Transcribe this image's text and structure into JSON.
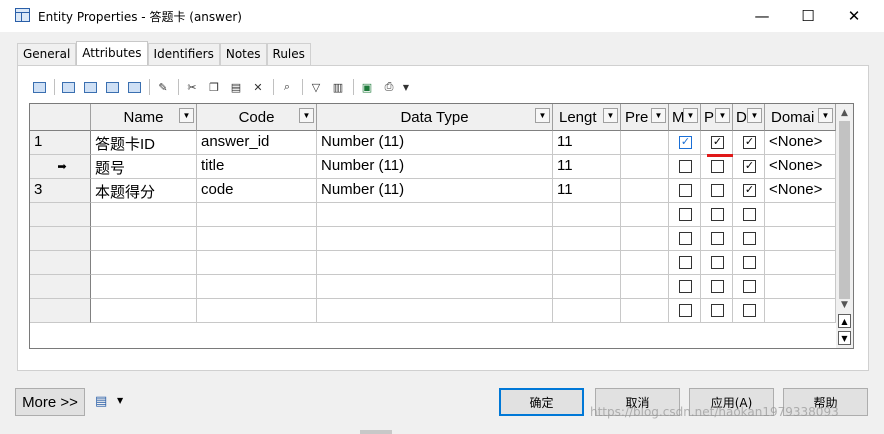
{
  "window": {
    "title": "Entity Properties - 答题卡 (answer)",
    "minimize": "—",
    "maximize": "☐",
    "close": "✕"
  },
  "tabs": [
    {
      "label": "General",
      "active": false
    },
    {
      "label": "Attributes",
      "active": true
    },
    {
      "label": "Identifiers",
      "active": false
    },
    {
      "label": "Notes",
      "active": false
    },
    {
      "label": "Rules",
      "active": false
    }
  ],
  "grid": {
    "columns": [
      "Name",
      "Code",
      "Data Type",
      "Lengt",
      "Pre",
      "M",
      "P",
      "D",
      "Domai"
    ],
    "rows": [
      {
        "row_label": "1",
        "name": "答题卡ID",
        "code": "answer_id",
        "data_type": "Number (11)",
        "length": "11",
        "precision": "",
        "mandatory": true,
        "primary": true,
        "displayed": true,
        "domain": "<None>"
      },
      {
        "row_label": "➡",
        "name": "题号",
        "code": "title",
        "data_type": "Number (11)",
        "length": "11",
        "precision": "",
        "mandatory": false,
        "primary": false,
        "displayed": true,
        "domain": "<None>"
      },
      {
        "row_label": "3",
        "name": "本题得分",
        "code": "code",
        "data_type": "Number (11)",
        "length": "11",
        "precision": "",
        "mandatory": false,
        "primary": false,
        "displayed": true,
        "domain": "<None>"
      }
    ],
    "empty_rows": 5
  },
  "buttons": {
    "more": "More >>",
    "ok": "确定",
    "cancel": "取消",
    "apply": "应用(A)",
    "help": "帮助"
  },
  "watermark": "https://blog.csdn.net/haokan1979338093"
}
